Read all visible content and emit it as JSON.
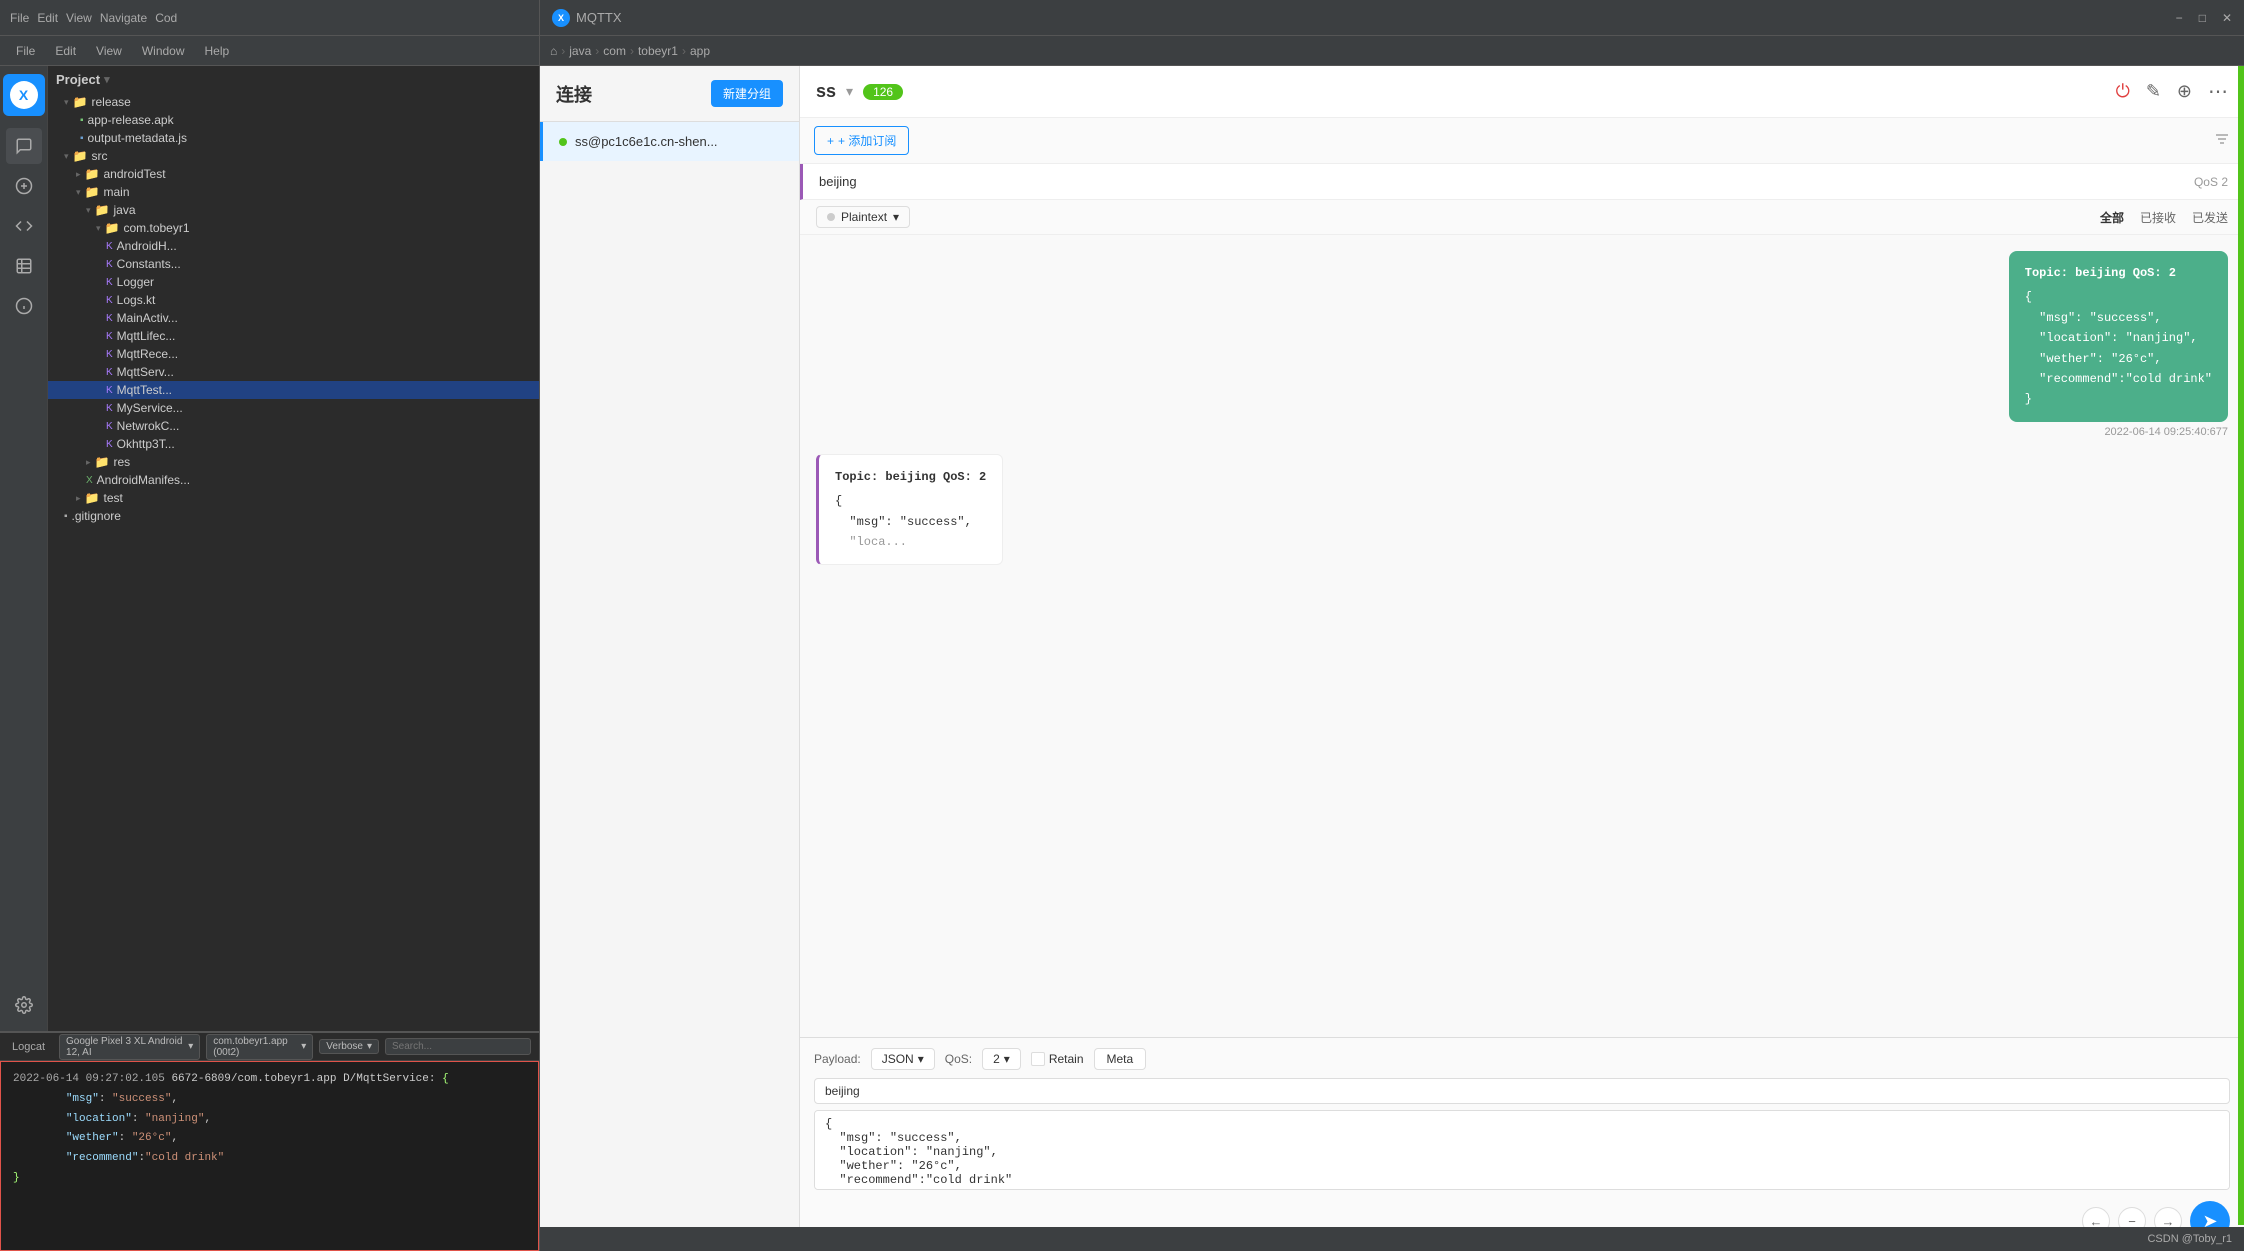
{
  "titleBar": {
    "ideTitle": "File  Edit  View  Navigate  Code",
    "mqttxTitle": "MQTTX",
    "minimizeLabel": "−",
    "maximizeLabel": "□",
    "closeLabel": "✕"
  },
  "ideMenu": {
    "items": [
      "File",
      "Edit",
      "View",
      "Navigate",
      "Cod"
    ]
  },
  "mqttxMenu": {
    "items": [
      "File",
      "Edit",
      "View",
      "Window",
      "Help"
    ]
  },
  "breadcrumb": {
    "parts": [
      "java",
      "com",
      "tobeyr1",
      "app"
    ]
  },
  "fileTree": {
    "header": "Project",
    "items": [
      {
        "label": "release",
        "type": "folder",
        "depth": 1,
        "selected": false
      },
      {
        "label": "app-release.apk",
        "type": "apk",
        "depth": 2,
        "selected": false
      },
      {
        "label": "output-metadata.js",
        "type": "file",
        "depth": 2,
        "selected": false
      },
      {
        "label": "src",
        "type": "folder",
        "depth": 1,
        "selected": false
      },
      {
        "label": "androidTest",
        "type": "folder",
        "depth": 2,
        "selected": false
      },
      {
        "label": "main",
        "type": "folder",
        "depth": 2,
        "selected": false
      },
      {
        "label": "java",
        "type": "folder",
        "depth": 3,
        "selected": false
      },
      {
        "label": "com.tobeyr1",
        "type": "folder",
        "depth": 4,
        "selected": false
      },
      {
        "label": "AndroidH...",
        "type": "kotlin",
        "depth": 5,
        "selected": false
      },
      {
        "label": "Constants...",
        "type": "kotlin",
        "depth": 5,
        "selected": false
      },
      {
        "label": "Logger",
        "type": "kotlin",
        "depth": 5,
        "selected": false
      },
      {
        "label": "Logs.kt",
        "type": "kotlin",
        "depth": 5,
        "selected": false
      },
      {
        "label": "MainActiv...",
        "type": "kotlin",
        "depth": 5,
        "selected": false
      },
      {
        "label": "MqttLifec...",
        "type": "kotlin",
        "depth": 5,
        "selected": false
      },
      {
        "label": "MqttRece...",
        "type": "kotlin",
        "depth": 5,
        "selected": false
      },
      {
        "label": "MqttServ...",
        "type": "kotlin",
        "depth": 5,
        "selected": false
      },
      {
        "label": "MqttTest...",
        "type": "kotlin",
        "depth": 5,
        "selected": true
      },
      {
        "label": "MyService...",
        "type": "kotlin",
        "depth": 5,
        "selected": false
      },
      {
        "label": "NetwrokC...",
        "type": "kotlin",
        "depth": 5,
        "selected": false
      },
      {
        "label": "Okhttp3T...",
        "type": "kotlin",
        "depth": 5,
        "selected": false
      },
      {
        "label": "res",
        "type": "folder",
        "depth": 3,
        "selected": false
      },
      {
        "label": "AndroidManifes...",
        "type": "xml",
        "depth": 3,
        "selected": false
      },
      {
        "label": "test",
        "type": "folder",
        "depth": 2,
        "selected": false
      },
      {
        "label": ".gitignore",
        "type": "file",
        "depth": 1,
        "selected": false
      }
    ]
  },
  "connection": {
    "title": "连接",
    "newGroupBtn": "新建分组",
    "items": [
      {
        "name": "ss@pc1c6e1c.cn-shen...",
        "status": "connected"
      }
    ]
  },
  "chat": {
    "connName": "ss",
    "badge": "126",
    "addSubBtn": "+ 添加订阅",
    "topics": [
      {
        "name": "beijing",
        "qos": "QoS 2"
      }
    ],
    "filterLabels": {
      "all": "全部",
      "received": "已接收",
      "sent": "已发送"
    },
    "plaintextLabel": "Plaintext",
    "messages": [
      {
        "type": "sent",
        "topicHeader": "Topic: beijing    QoS: 2",
        "content": "{\n  \"msg\": \"success\",\n  \"location\": \"nanjing\",\n  \"wether\": \"26°c\",\n  \"recommend\":\"cold drink\"\n}",
        "timestamp": "2022-06-14 09:25:40:677"
      },
      {
        "type": "received",
        "topicHeader": "Topic: beijing    QoS: 2",
        "content": "{\n  \"msg\": \"success\",\n  \"loca..."
      }
    ]
  },
  "publish": {
    "payloadLabel": "Payload:",
    "payloadFormat": "JSON",
    "qosLabel": "QoS:",
    "qosValue": "2",
    "retainLabel": "Retain",
    "metaLabel": "Meta",
    "topicValue": "beijing",
    "payloadValue": "{\n  \"msg\": \"success\",\n  \"location\": \"nanjing\",\n  \"wether\": \"26°c\",\n  \"recommend\":\"cold drink\""
  },
  "console": {
    "tab": "Logcat",
    "deviceLabel": "Google Pixel 3 XL  Android 12, AI",
    "packageLabel": "com.tobeyr1.app (00t2)",
    "logLevel": "Verbose",
    "content": {
      "timestamp": "2022-06-14 09:27:02.105",
      "tag": "6672-6809/com.tobeyr1.app D/MqttService:",
      "payload": "{\n        \"msg\": \"success\",\n        \"location\": \"nanjing\",\n        \"wether\": \"26°c\",\n        \"recommend\":\"cold drink\"\n}"
    }
  },
  "statusBar": {
    "rightText": "CSDN @Toby_r1"
  }
}
